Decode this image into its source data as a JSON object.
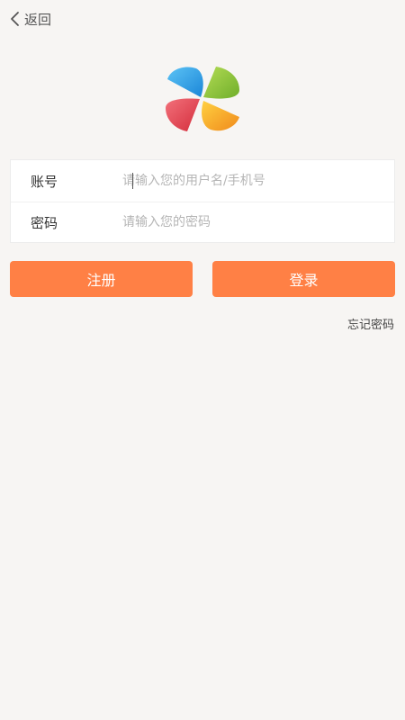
{
  "header": {
    "back_label": "返回",
    "back_icon": "chevron-left-icon"
  },
  "logo": {
    "icon": "pinwheel-logo",
    "colors": {
      "blue": "#2fa6e8",
      "green": "#8cc63e",
      "red": "#e84350",
      "orange": "#f5a623"
    }
  },
  "form": {
    "account": {
      "label": "账号",
      "placeholder": "请输入您的用户名/手机号",
      "value": ""
    },
    "password": {
      "label": "密码",
      "placeholder": "请输入您的密码",
      "value": ""
    }
  },
  "actions": {
    "register_label": "注册",
    "login_label": "登录",
    "forgot_label": "忘记密码"
  },
  "colors": {
    "accent": "#ff8045",
    "background": "#f7f5f3"
  }
}
